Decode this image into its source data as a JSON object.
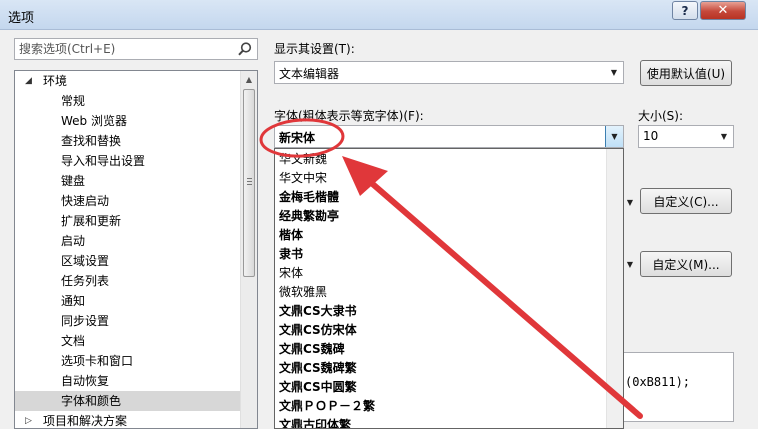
{
  "window": {
    "title": "选项",
    "help_label": "?",
    "close_label": "✕"
  },
  "search": {
    "placeholder": "搜索选项(Ctrl+E)"
  },
  "tree": {
    "root_label": "环境",
    "items": [
      "常规",
      "Web 浏览器",
      "查找和替换",
      "导入和导出设置",
      "键盘",
      "快速启动",
      "扩展和更新",
      "启动",
      "区域设置",
      "任务列表",
      "通知",
      "同步设置",
      "文档",
      "选项卡和窗口",
      "自动恢复",
      "字体和颜色"
    ],
    "selected": "字体和颜色",
    "next_root_label": "项目和解决方案"
  },
  "settings": {
    "display_label": "显示其设置(T):",
    "display_value": "文本编辑器",
    "use_defaults_label": "使用默认值(U)",
    "font_label": "字体(粗体表示等宽字体)(F):",
    "font_value": "新宋体",
    "size_label": "大小(S):",
    "size_value": "10",
    "custom_c_label": "自定义(C)...",
    "custom_m_label": "自定义(M)...",
    "sample_text": "(0xB811);"
  },
  "font_list": [
    {
      "name": "华文新魏",
      "bold": false
    },
    {
      "name": "华文中宋",
      "bold": false
    },
    {
      "name": "金梅毛楷體",
      "bold": true
    },
    {
      "name": "经典繁勘亭",
      "bold": true
    },
    {
      "name": "楷体",
      "bold": true
    },
    {
      "name": "隶书",
      "bold": true
    },
    {
      "name": "宋体",
      "bold": false
    },
    {
      "name": "微软雅黑",
      "bold": false
    },
    {
      "name": "文鼎CS大隶书",
      "bold": true
    },
    {
      "name": "文鼎CS仿宋体",
      "bold": true
    },
    {
      "name": "文鼎CS魏碑",
      "bold": true
    },
    {
      "name": "文鼎CS魏碑繁",
      "bold": true
    },
    {
      "name": "文鼎CS中圆繁",
      "bold": true
    },
    {
      "name": "文鼎ＰＯＰ－２繁",
      "bold": true
    },
    {
      "name": "文鼎古印体繁",
      "bold": true
    }
  ],
  "colors": {
    "annotation": "#e0373a"
  }
}
